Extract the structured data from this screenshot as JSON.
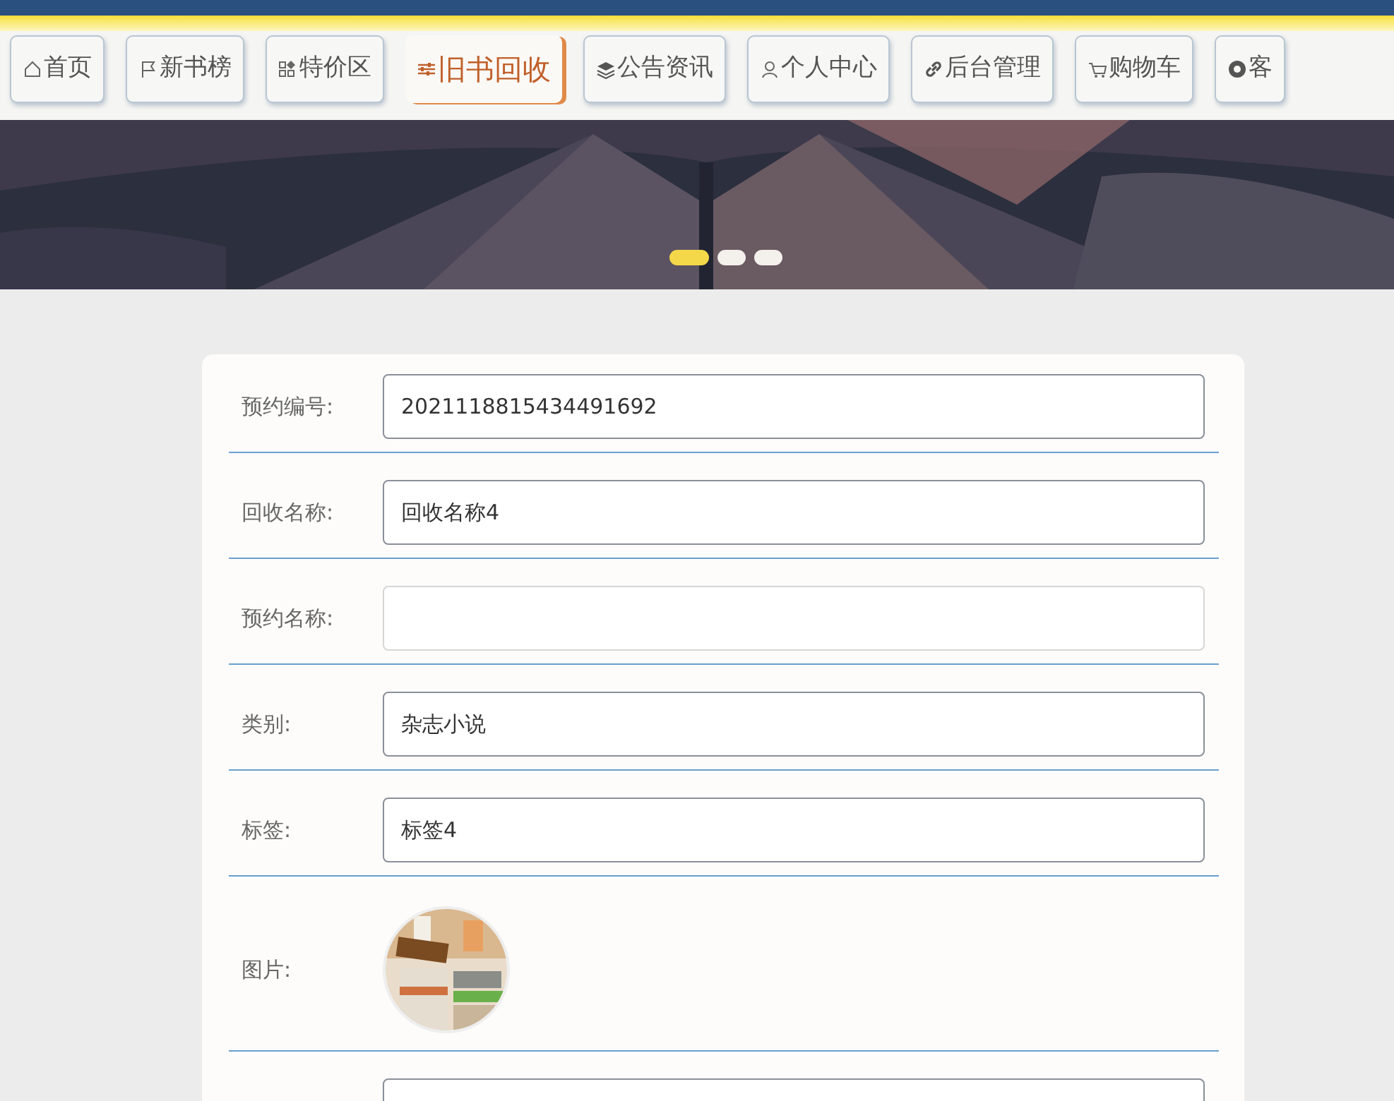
{
  "nav": [
    {
      "label": "首页",
      "selected": false
    },
    {
      "label": "新书榜",
      "selected": false
    },
    {
      "label": "特价区",
      "selected": false
    },
    {
      "label": "旧书回收",
      "selected": true
    },
    {
      "label": "公告资讯",
      "selected": false
    },
    {
      "label": "个人中心",
      "selected": false
    },
    {
      "label": "后台管理",
      "selected": false
    },
    {
      "label": "购物车",
      "selected": false
    },
    {
      "label": "客",
      "selected": false
    }
  ],
  "banner": {
    "kind": "picture",
    "indicators": [
      {
        "selected": true
      },
      {
        "selected": false
      },
      {
        "selected": false
      }
    ]
  },
  "form": {
    "fields": [
      {
        "kind": "text",
        "label": "预约编号:",
        "value": "2021118815434491692",
        "focused": false
      },
      {
        "kind": "text",
        "label": "回收名称:",
        "value": "回收名称4",
        "focused": false
      },
      {
        "kind": "text",
        "label": "预约名称:",
        "focused": true
      },
      {
        "kind": "text",
        "label": "类别:",
        "value": "杂志小说",
        "focused": false
      },
      {
        "kind": "text",
        "label": "标签:",
        "value": "标签4",
        "focused": false
      },
      {
        "label": "图片:"
      },
      {
        "kind": "text",
        "focused": false
      }
    ]
  }
}
